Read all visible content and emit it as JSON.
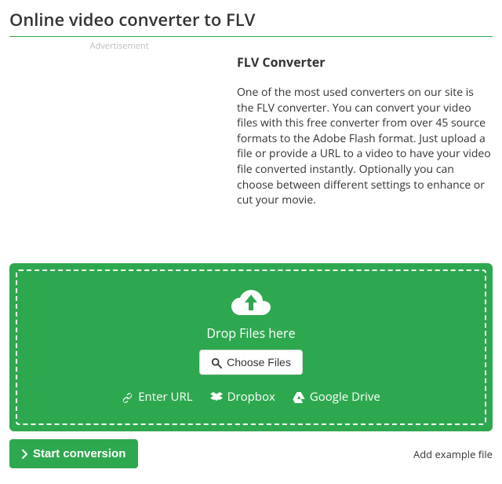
{
  "page": {
    "title": "Online video converter to FLV",
    "ad_label": "Advertisement"
  },
  "intro": {
    "heading": "FLV Converter",
    "body": "One of the most used converters on our site is the FLV converter. You can convert your video files with this free converter from over 45 source formats to the Adobe Flash format. Just upload a file or provide a URL to a video to have your video file converted instantly. Optionally you can choose between different settings to enhance or cut your movie."
  },
  "dropzone": {
    "drop_label": "Drop Files here",
    "choose_label": "Choose Files",
    "sources": {
      "url": "Enter URL",
      "dropbox": "Dropbox",
      "gdrive": "Google Drive"
    }
  },
  "actions": {
    "start_label": "Start conversion",
    "example_label": "Add example file"
  },
  "colors": {
    "accent": "#2ea84f"
  }
}
